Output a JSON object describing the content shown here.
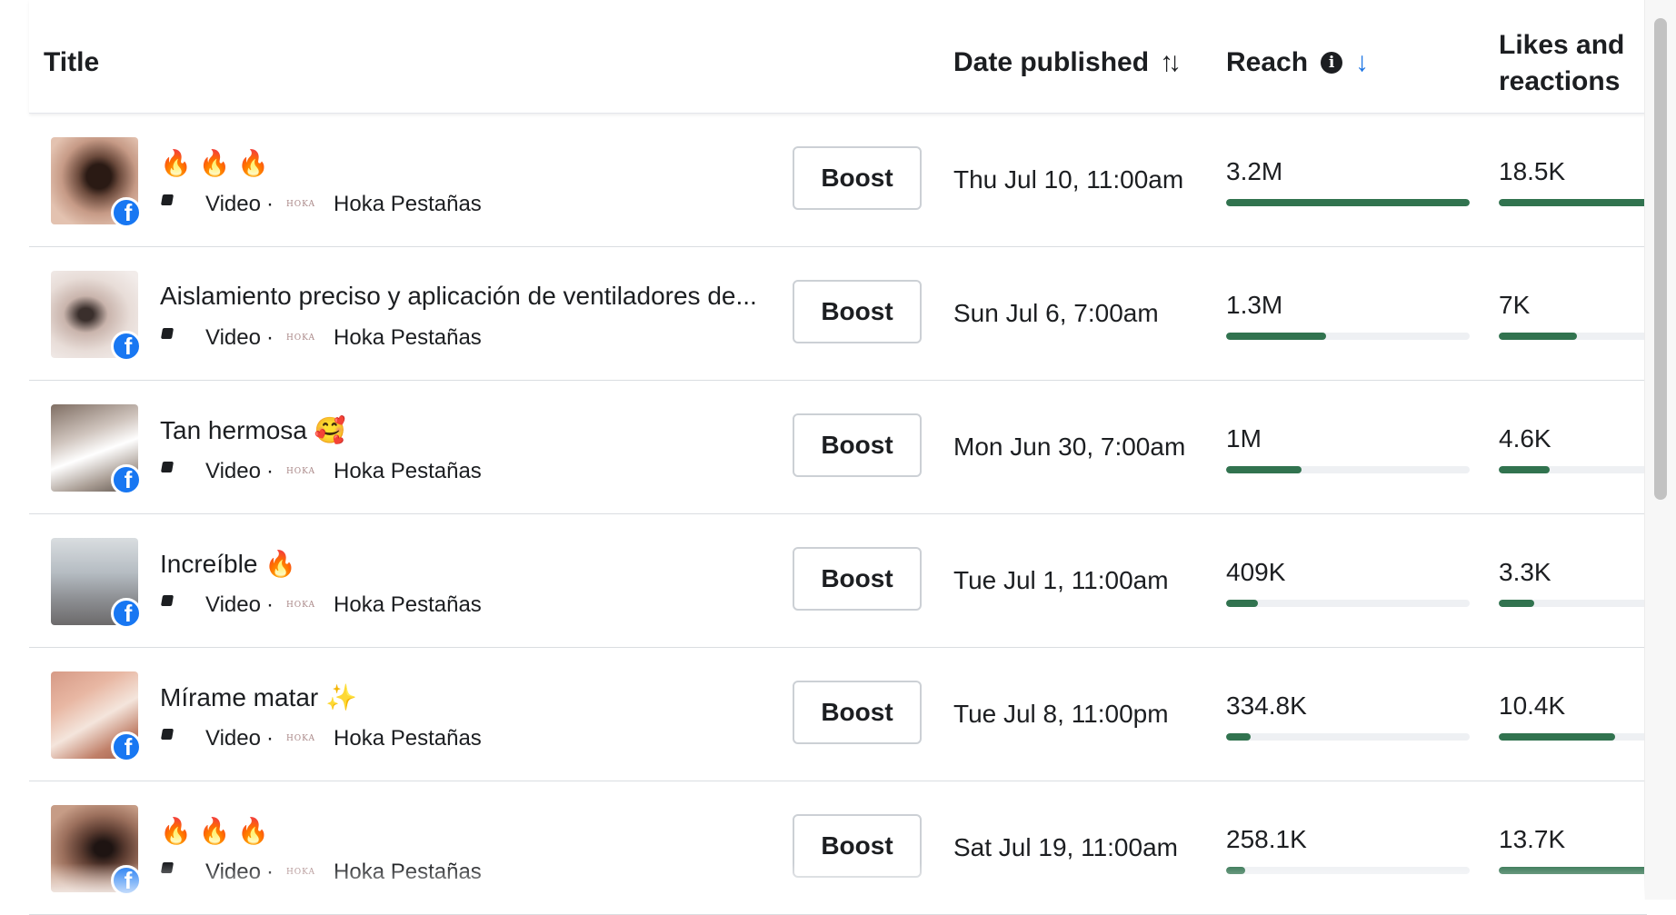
{
  "header": {
    "title": "Title",
    "date_published": "Date published",
    "date_sort_icon": "↑↓",
    "reach": "Reach",
    "reach_sort_icon": "↓",
    "likes_line1": "Likes and",
    "likes_line2": "reactions"
  },
  "colors": {
    "bar_fill": "#31734f",
    "bar_track": "#eef0f3",
    "facebook_blue": "#1877f2",
    "sort_active": "#1b74e4"
  },
  "rows": [
    {
      "title": "🔥 🔥 🔥",
      "type": "Video",
      "page": "Hoka Pestañas",
      "page_logo": "HOKA",
      "boost": "Boost",
      "date": "Thu Jul 10, 11:00am",
      "reach": "3.2M",
      "reach_fraction": 1.0,
      "likes": "18.5K",
      "likes_fraction": 1.0
    },
    {
      "title": "Aislamiento preciso y aplicación de ventiladores de...",
      "type": "Video",
      "page": "Hoka Pestañas",
      "page_logo": "HOKA",
      "boost": "Boost",
      "date": "Sun Jul 6, 7:00am",
      "reach": "1.3M",
      "reach_fraction": 0.41,
      "likes": "7K",
      "likes_fraction": 0.5
    },
    {
      "title": "Tan hermosa 🥰",
      "type": "Video",
      "page": "Hoka Pestañas",
      "page_logo": "HOKA",
      "boost": "Boost",
      "date": "Mon Jun 30, 7:00am",
      "reach": "1M",
      "reach_fraction": 0.31,
      "likes": "4.6K",
      "likes_fraction": 0.33
    },
    {
      "title": "Increíble 🔥",
      "type": "Video",
      "page": "Hoka Pestañas",
      "page_logo": "HOKA",
      "boost": "Boost",
      "date": "Tue Jul 1, 11:00am",
      "reach": "409K",
      "reach_fraction": 0.13,
      "likes": "3.3K",
      "likes_fraction": 0.23
    },
    {
      "title": "Mírame matar ✨",
      "type": "Video",
      "page": "Hoka Pestañas",
      "page_logo": "HOKA",
      "boost": "Boost",
      "date": "Tue Jul 8, 11:00pm",
      "reach": "334.8K",
      "reach_fraction": 0.1,
      "likes": "10.4K",
      "likes_fraction": 0.75
    },
    {
      "title": "🔥 🔥 🔥",
      "type": "Video",
      "page": "Hoka Pestañas",
      "page_logo": "HOKA",
      "boost": "Boost",
      "date": "Sat Jul 19, 11:00am",
      "reach": "258.1K",
      "reach_fraction": 0.08,
      "likes": "13.7K",
      "likes_fraction": 1.0
    }
  ]
}
